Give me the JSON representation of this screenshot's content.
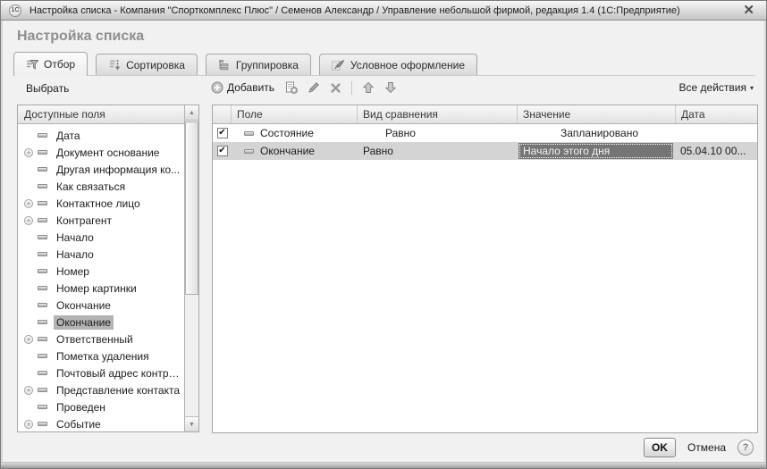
{
  "window": {
    "title": "Настройка списка - Компания \"Спорткомплекс Плюс\" / Семенов Александр / Управление небольшой фирмой, редакция 1.4  (1С:Предприятие)",
    "logo_text": "1С",
    "close_glyph": "✕"
  },
  "page_title": "Настройка списка",
  "tabs": [
    {
      "label": "Отбор",
      "icon": "filter-icon",
      "active": true
    },
    {
      "label": "Сортировка",
      "icon": "sort-icon",
      "active": false
    },
    {
      "label": "Группировка",
      "icon": "grouping-icon",
      "active": false
    },
    {
      "label": "Условное оформление",
      "icon": "brush-icon",
      "active": false
    }
  ],
  "left_panel": {
    "select_button": "Выбрать",
    "header": "Доступные поля",
    "items": [
      {
        "label": "Дата",
        "expandable": false,
        "selected": false
      },
      {
        "label": "Документ основание",
        "expandable": true,
        "selected": false
      },
      {
        "label": "Другая информация ко...",
        "expandable": false,
        "selected": false
      },
      {
        "label": "Как связаться",
        "expandable": false,
        "selected": false
      },
      {
        "label": "Контактное лицо",
        "expandable": true,
        "selected": false
      },
      {
        "label": "Контрагент",
        "expandable": true,
        "selected": false
      },
      {
        "label": "Начало",
        "expandable": false,
        "selected": false
      },
      {
        "label": "Начало",
        "expandable": false,
        "selected": false
      },
      {
        "label": "Номер",
        "expandable": false,
        "selected": false
      },
      {
        "label": "Номер картинки",
        "expandable": false,
        "selected": false
      },
      {
        "label": "Окончание",
        "expandable": false,
        "selected": false
      },
      {
        "label": "Окончание",
        "expandable": false,
        "selected": true
      },
      {
        "label": "Ответственный",
        "expandable": true,
        "selected": false
      },
      {
        "label": "Пометка удаления",
        "expandable": false,
        "selected": false
      },
      {
        "label": "Почтовый адрес контра...",
        "expandable": false,
        "selected": false
      },
      {
        "label": "Представление контакта",
        "expandable": true,
        "selected": false
      },
      {
        "label": "Проведен",
        "expandable": false,
        "selected": false
      },
      {
        "label": "Событие",
        "expandable": true,
        "selected": false
      }
    ]
  },
  "toolbar": {
    "add_label": "Добавить",
    "buttons": [
      "add",
      "add-group",
      "edit",
      "delete",
      "move-up",
      "move-down"
    ],
    "all_actions_label": "Все действия",
    "all_actions_caret": "▾"
  },
  "table": {
    "columns": [
      "Поле",
      "Вид сравнения",
      "Значение",
      "Дата"
    ],
    "rows": [
      {
        "checked": true,
        "field": "Состояние",
        "comparison": "Равно",
        "value": "Запланировано",
        "date": "",
        "selected": false
      },
      {
        "checked": true,
        "field": "Окончание",
        "comparison": "Равно",
        "value": "Начало этого дня",
        "date": "05.04.10 00...",
        "selected": true
      }
    ],
    "check_glyph": "✔"
  },
  "footer": {
    "ok_label": "OK",
    "cancel_label": "Отмена",
    "help_label": "?"
  },
  "colors": {
    "selected_cell_bg": "#757575",
    "selected_row_bg": "#d4d4d4",
    "selected_item_bg": "#b3b3b3",
    "titlebar_gradient_top": "#f7f7f7",
    "titlebar_gradient_bottom": "#c4c4c4"
  }
}
